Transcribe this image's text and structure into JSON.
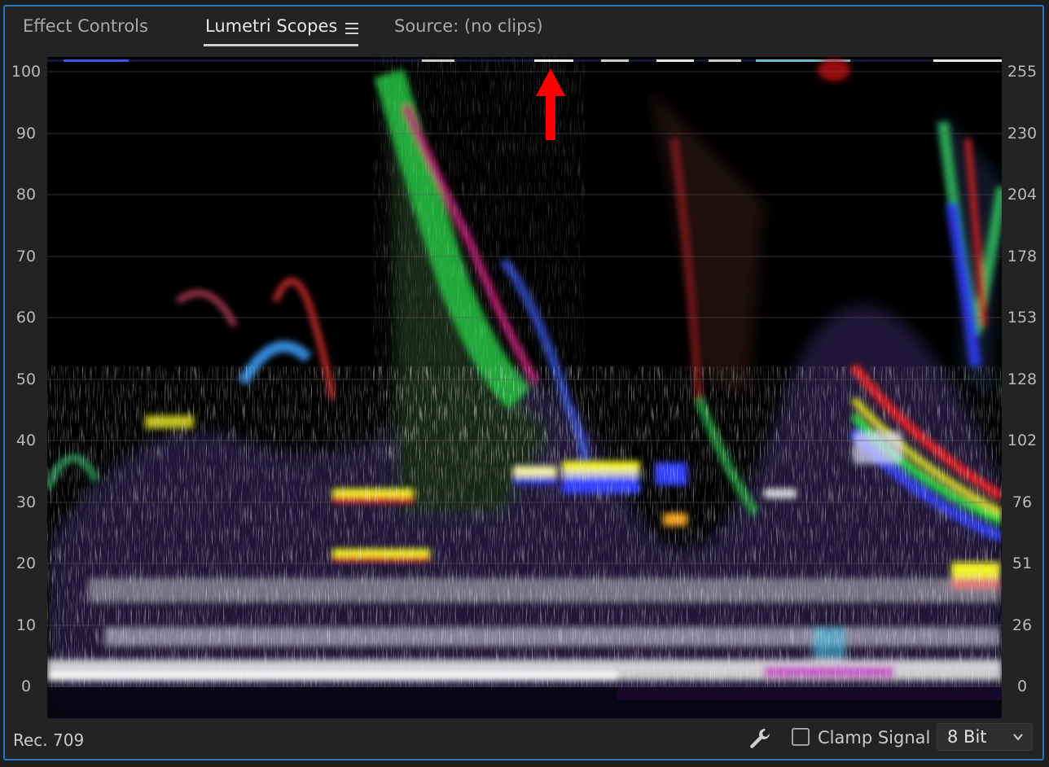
{
  "tabs": {
    "effect_controls": "Effect Controls",
    "lumetri_scopes": "Lumetri Scopes",
    "source": "Source: (no clips)"
  },
  "scope": {
    "type": "waveform RGB",
    "left_ticks": [
      "100",
      "90",
      "80",
      "70",
      "60",
      "50",
      "40",
      "30",
      "20",
      "10",
      "0"
    ],
    "right_ticks": [
      "255",
      "230",
      "204",
      "178",
      "153",
      "128",
      "102",
      "76",
      "51",
      "26",
      "0"
    ],
    "annotation": "red up arrow near top edge",
    "colors": {
      "red": "#ff2020",
      "green": "#20ff40",
      "blue": "#3040ff",
      "yellow": "#f0f020"
    }
  },
  "footer": {
    "colorspace": "Rec. 709",
    "clamp_signal_label": "Clamp Signal",
    "clamp_signal_checked": false,
    "bit_depth": "8 Bit",
    "wrench_icon": "wrench-icon"
  }
}
